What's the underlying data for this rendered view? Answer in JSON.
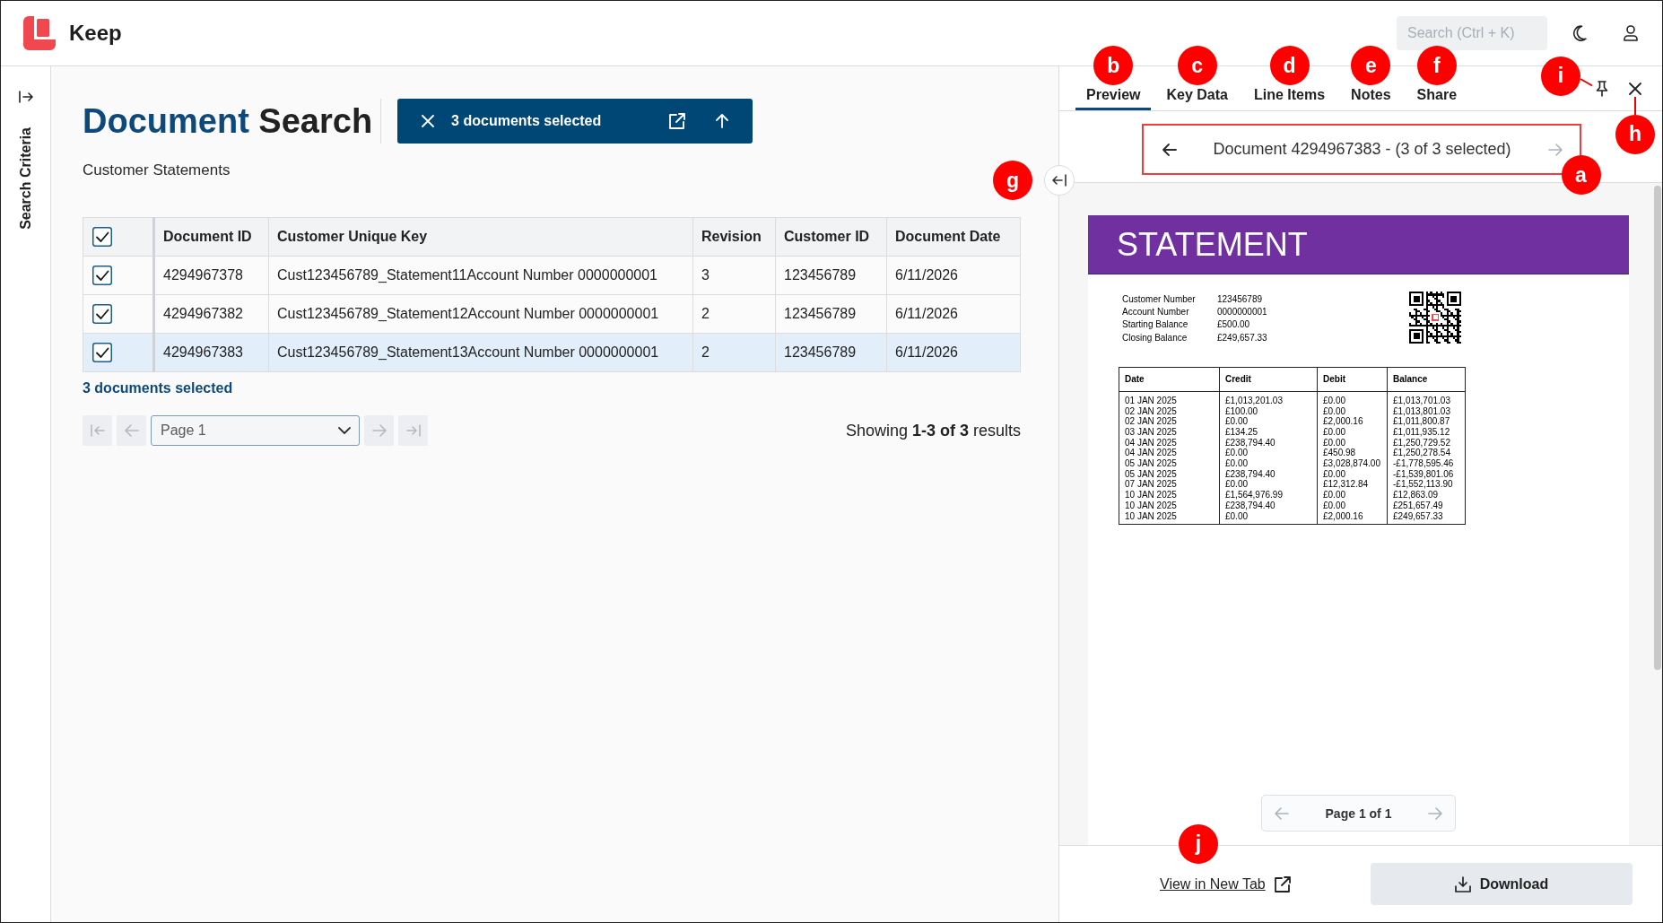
{
  "app": {
    "name": "Keep",
    "search": {
      "placeholder": "Search (Ctrl + K)"
    }
  },
  "sidebar": {
    "label": "Search Criteria"
  },
  "document_search": {
    "title": {
      "lead": "Document",
      "rest": "Search"
    },
    "selection_bar": {
      "label": "3 documents selected"
    },
    "subtitle": "Customer Statements",
    "table": {
      "select_all_checked": true,
      "columns": [
        "Document ID",
        "Customer Unique Key",
        "Revision",
        "Customer ID",
        "Document Date"
      ],
      "rows": [
        {
          "checked": true,
          "selected": false,
          "cells": [
            "4294967378",
            "Cust123456789_Statement11Account Number 0000000001",
            "3",
            "123456789",
            "6/11/2026"
          ]
        },
        {
          "checked": true,
          "selected": false,
          "cells": [
            "4294967382",
            "Cust123456789_Statement12Account Number 0000000001",
            "2",
            "123456789",
            "6/11/2026"
          ]
        },
        {
          "checked": true,
          "selected": true,
          "cells": [
            "4294967383",
            "Cust123456789_Statement13Account Number 0000000001",
            "2",
            "123456789",
            "6/11/2026"
          ]
        }
      ]
    },
    "selection_summary": "3 documents selected",
    "pagination": {
      "buttons": [
        {
          "kind": "first",
          "disabled": true
        },
        {
          "kind": "previous",
          "disabled": true
        },
        {
          "kind": "next",
          "disabled": true
        },
        {
          "kind": "last",
          "disabled": true
        }
      ],
      "page": "Page 1",
      "summary": "Showing **1-3 of 3** results"
    }
  },
  "preview": {
    "tabs": [
      {
        "label": "Preview",
        "selected": true,
        "callout": "b"
      },
      {
        "label": "Key Data",
        "selected": false,
        "callout": "c"
      },
      {
        "label": "Line Items",
        "selected": false,
        "callout": "d"
      },
      {
        "label": "Notes",
        "selected": false,
        "callout": "e"
      },
      {
        "label": "Share",
        "selected": false,
        "callout": "f"
      }
    ],
    "pin": {
      "callout": "i"
    },
    "close": {
      "callout": "h"
    },
    "collapse": {
      "callout": "g"
    },
    "navigator": {
      "title": "Document 4294967383 - (3 of 3 selected)",
      "prev_disabled": false,
      "next_disabled": true,
      "framed": true,
      "callout": "a"
    },
    "document": {
      "heading": "STATEMENT",
      "details": [
        {
          "label": "Customer Number",
          "value": "123456789"
        },
        {
          "label": "Account Number",
          "value": "0000000001"
        },
        {
          "label": "Starting Balance",
          "value": "£500.00"
        },
        {
          "label": "Closing Balance",
          "value": "£249,657.33"
        }
      ],
      "table": {
        "columns": [
          "Date",
          "Credit",
          "Debit",
          "Balance"
        ],
        "rows": [
          [
            "01 JAN 2025",
            "£1,013,201.03",
            "£0.00",
            "£1,013,701.03"
          ],
          [
            "02 JAN 2025",
            "£100.00",
            "£0.00",
            "£1,013,801.03"
          ],
          [
            "02 JAN 2025",
            "£0.00",
            "£2,000.16",
            "£1,011,800.87"
          ],
          [
            "03 JAN 2025",
            "£134.25",
            "£0.00",
            "£1,011,935.12"
          ],
          [
            "04 JAN 2025",
            "£238,794.40",
            "£0.00",
            "£1,250,729.52"
          ],
          [
            "04 JAN 2025",
            "£0.00",
            "£450.98",
            "£1,250,278.54"
          ],
          [
            "05 JAN 2025",
            "£0.00",
            "£3,028,874.00",
            "-£1,778,595.46"
          ],
          [
            "05 JAN 2025",
            "£238,794.40",
            "£0.00",
            "-£1,539,801.06"
          ],
          [
            "07 JAN 2025",
            "£0.00",
            "£12,312.84",
            "-£1,552,113.90"
          ],
          [
            "10 JAN 2025",
            "£1,564,976.99",
            "£0.00",
            "£12,863.09"
          ],
          [
            "10 JAN 2025",
            "£238,794.40",
            "£0.00",
            "£251,657.49"
          ],
          [
            "10 JAN 2025",
            "£0.00",
            "£2,000.16",
            "£249,657.33"
          ]
        ]
      }
    },
    "page_nav": {
      "label": "Page 1 of 1",
      "prev_disabled": true,
      "next_disabled": true
    },
    "open_link": {
      "label": "View in New Tab",
      "callout": "j"
    },
    "download": {
      "label": "Download"
    }
  }
}
